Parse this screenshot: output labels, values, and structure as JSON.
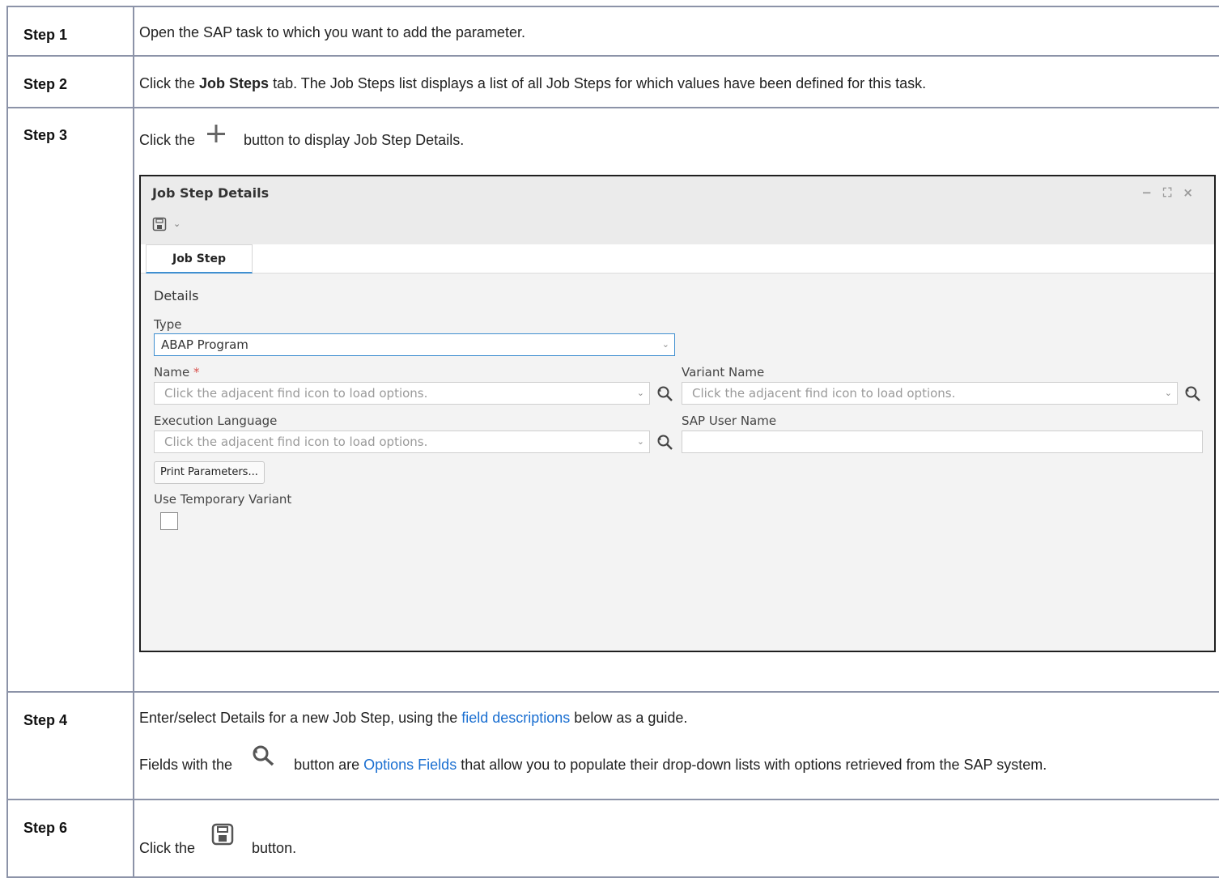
{
  "steps": [
    {
      "label": "Step 1",
      "text": "Open the SAP task to which you want to add the parameter."
    },
    {
      "label": "Step 2",
      "prefix": "Click the ",
      "bold": "Job Steps",
      "suffix": " tab. The Job Steps list displays a list of all Job Steps for which values have been defined for this task."
    },
    {
      "label": "Step 3",
      "prefix": "Click the ",
      "suffix": " button to display Job Step Details.",
      "icon": "plus-icon"
    },
    {
      "label": "Step 4",
      "line1_prefix": "Enter/select Details for a new Job Step, using the ",
      "line1_link": "field descriptions",
      "line1_suffix": " below as a guide.",
      "line2_prefix": "Fields with the ",
      "line2_mid": " button are ",
      "line2_link": "Options Fields",
      "line2_suffix": " that allow you to populate their drop-down lists with options retrieved from the SAP system.",
      "icon": "find-refresh-icon"
    },
    {
      "label": "Step 6",
      "prefix": "Click the ",
      "suffix": " button.",
      "icon": "save-icon"
    }
  ],
  "window": {
    "title": "Job Step Details",
    "controls": [
      "−",
      "⛶",
      "×"
    ],
    "tab": "Job Step",
    "section": "Details",
    "type_label": "Type",
    "type_value": "ABAP Program",
    "name_label": "Name",
    "required_mark": "*",
    "variant_label": "Variant Name",
    "exec_label": "Execution Language",
    "sap_user_label": "SAP User Name",
    "placeholder": "Click the adjacent find icon to load options.",
    "print_button": "Print Parameters...",
    "temp_variant_label": "Use Temporary Variant"
  },
  "colors": {
    "link": "#1a6fd1",
    "border": "#8c93a8",
    "accent": "#3f8fd0",
    "required": "#d9534f"
  }
}
